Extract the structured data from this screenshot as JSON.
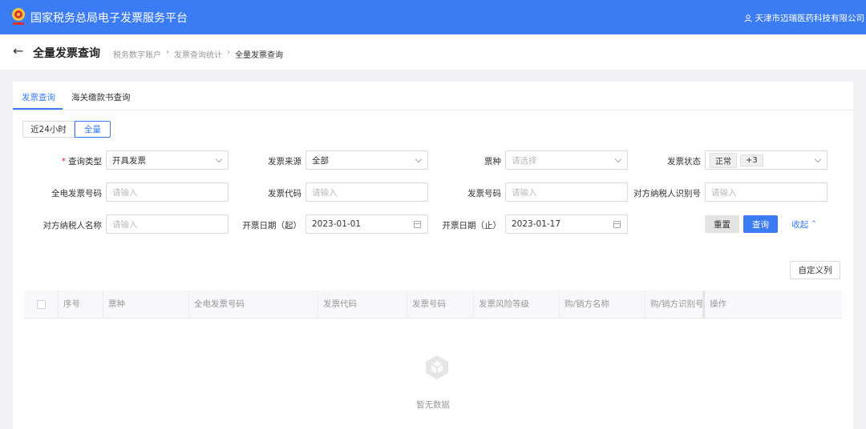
{
  "header": {
    "app_title": "国家税务总局电子发票服务平台",
    "user": "天津市迈瑞医药科技有限公司",
    "brand_color": "#3b7cf5"
  },
  "page": {
    "title": "全量发票查询",
    "breadcrumb": [
      "税务数字账户",
      "发票查询统计",
      "全量发票查询"
    ]
  },
  "tabs": [
    {
      "label": "发票查询",
      "active": true
    },
    {
      "label": "海关缴款书查询",
      "active": false
    }
  ],
  "time_range": [
    {
      "label": "近24小时",
      "active": false
    },
    {
      "label": "全量",
      "active": true
    }
  ],
  "filters": {
    "query_type": {
      "label": "查询类型",
      "required": true,
      "value": "开具发票"
    },
    "source": {
      "label": "发票来源",
      "value": "全部"
    },
    "ticket_type": {
      "label": "票种",
      "placeholder": "请选择"
    },
    "status": {
      "label": "发票状态",
      "tag": "正常",
      "more": "+3"
    },
    "full_invoice_no": {
      "label": "全电发票号码",
      "placeholder": "请输入"
    },
    "invoice_code": {
      "label": "发票代码",
      "placeholder": "请输入"
    },
    "invoice_no": {
      "label": "发票号码",
      "placeholder": "请输入"
    },
    "counter_taxid": {
      "label": "对方纳税人识别号",
      "placeholder": "请输入"
    },
    "counter_name": {
      "label": "对方纳税人名称",
      "placeholder": "请输入"
    },
    "date_from": {
      "label": "开票日期（起）",
      "value": "2023-01-01"
    },
    "date_to": {
      "label": "开票日期（止）",
      "value": "2023-01-17"
    }
  },
  "actions": {
    "reset": "重置",
    "query": "查询",
    "collapse": "收起"
  },
  "table": {
    "custom_columns": "自定义列",
    "columns": [
      "序号",
      "票种",
      "全电发票号码",
      "发票代码",
      "发票号码",
      "发票风险等级",
      "购/销方名称",
      "购/销方识别号",
      "操作"
    ],
    "empty_text": "暂无数据"
  }
}
